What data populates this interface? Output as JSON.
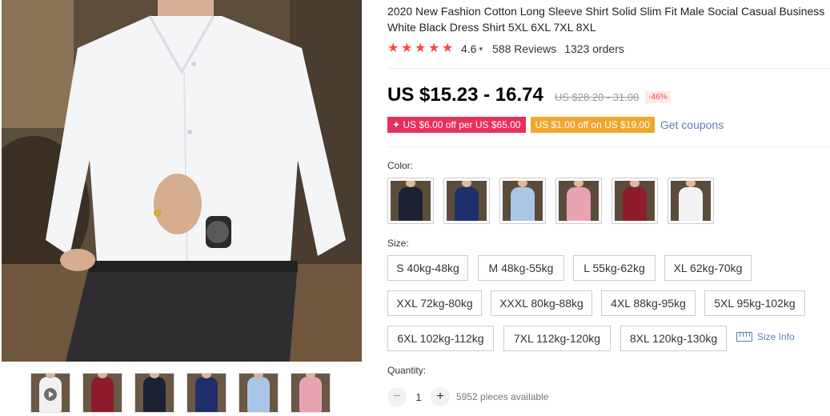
{
  "product": {
    "title": "2020 New Fashion Cotton Long Sleeve Shirt Solid Slim Fit Male Social Casual Business White Black Dress Shirt 5XL 6XL 7XL 8XL",
    "rating": "4.6",
    "rating_stars": 5,
    "reviews": "588 Reviews",
    "orders": "1323 orders",
    "price": "US $15.23 - 16.74",
    "original_price": "US $28.20 - 31.00",
    "discount": "-46%"
  },
  "coupons": {
    "store_coupon": "US $6.00 off per US $65.00",
    "select_coupon": "US $1.00 off on US $19.00",
    "get_coupons": "Get coupons"
  },
  "color": {
    "label": "Color:",
    "options": [
      {
        "name": "black-shirt",
        "hex": "#1c2233"
      },
      {
        "name": "navy-shirt",
        "hex": "#1f2f6b"
      },
      {
        "name": "light-blue-shirt",
        "hex": "#a9c6e6"
      },
      {
        "name": "pink-shirt",
        "hex": "#e8a3b1"
      },
      {
        "name": "wine-red-shirt",
        "hex": "#8e1c2c"
      },
      {
        "name": "white-shirt",
        "hex": "#f3f3f3"
      }
    ]
  },
  "size": {
    "label": "Size:",
    "options": [
      "S 40kg-48kg",
      "M 48kg-55kg",
      "L 55kg-62kg",
      "XL 62kg-70kg",
      "XXL 72kg-80kg",
      "XXXL 80kg-88kg",
      "4XL 88kg-95kg",
      "5XL 95kg-102kg",
      "6XL 102kg-112kg",
      "7XL 112kg-120kg",
      "8XL 120kg-130kg"
    ],
    "size_info": "Size Info"
  },
  "quantity": {
    "label": "Quantity:",
    "minus": "−",
    "value": "1",
    "plus": "+",
    "available": "5952 pieces available"
  },
  "thumbnails": [
    {
      "name": "white-shirt-video",
      "hex": "#f1f1f1",
      "video": true
    },
    {
      "name": "wine-red-shirt",
      "hex": "#8e1c2c"
    },
    {
      "name": "black-shirt",
      "hex": "#1c2233"
    },
    {
      "name": "navy-shirt",
      "hex": "#1f2f6b"
    },
    {
      "name": "light-blue-shirt",
      "hex": "#a9c6e6"
    },
    {
      "name": "pink-shirt",
      "hex": "#e8a3b1"
    }
  ],
  "theme": {
    "star": "#ff4747",
    "coupon_red": "#e7305a",
    "coupon_orange": "#f0a72e",
    "link": "#5a7fb5"
  }
}
